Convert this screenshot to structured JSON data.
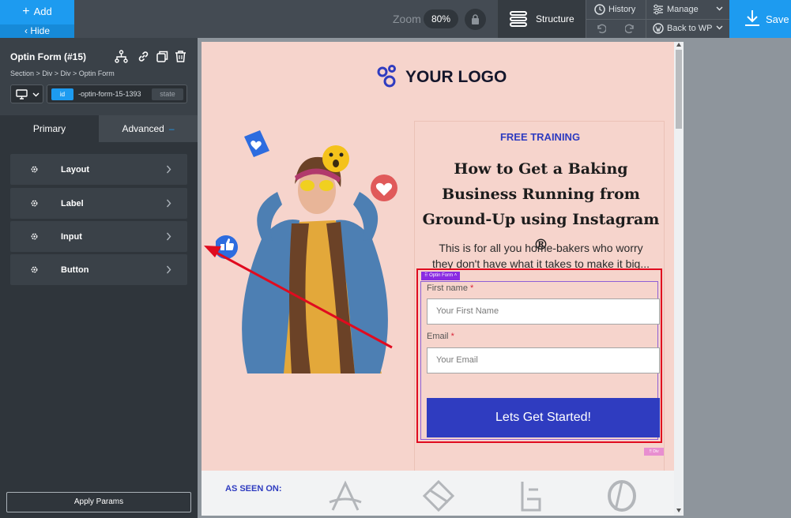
{
  "topbar": {
    "add_label": "Add",
    "hide_label": "Hide",
    "zoom_label": "Zoom",
    "zoom_value": "80%",
    "structure_label": "Structure",
    "history_label": "History",
    "manage_label": "Manage",
    "back_to_wp_label": "Back to WP",
    "save_label": "Save"
  },
  "sidebar": {
    "title": "Optin Form (#15)",
    "breadcrumb": "Section > Div > Div > Optin Form",
    "id_tag": "id",
    "id_value": "-optin-form-15-1393",
    "state_label": "state",
    "tabs": {
      "primary": "Primary",
      "advanced": "Advanced"
    },
    "sections": [
      "Layout",
      "Label",
      "Input",
      "Button"
    ],
    "apply_label": "Apply Params"
  },
  "page": {
    "logo_text": "YOUR LOGO",
    "free_training": "FREE TRAINING",
    "headline": "How to Get a Baking Business Running from Ground-Up using Instagram ®",
    "subtext": "This is for all you home-bakers who worry they don't have what it takes to make it big...",
    "optin_tag": "Optin Form",
    "first_name_label": "First name",
    "first_name_placeholder": "Your First Name",
    "email_label": "Email",
    "email_placeholder": "Your Email",
    "required_mark": "*",
    "button_label": "Lets Get Started!",
    "div_tag": "Div",
    "as_seen_on": "AS SEEN ON:"
  },
  "colors": {
    "accent": "#1d9bf0",
    "page_bg": "#f6d4cc",
    "brand_blue": "#2f3cc0",
    "selection_red": "#e00b1f"
  }
}
